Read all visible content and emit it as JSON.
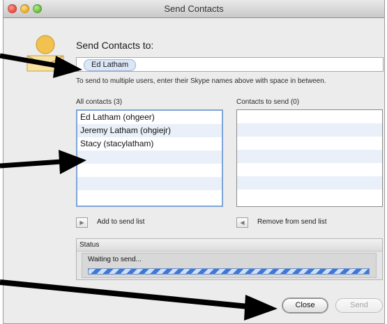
{
  "window": {
    "title": "Send Contacts"
  },
  "send_to": {
    "heading": "Send Contacts to:",
    "token": "Ed Latham",
    "hint": "To send to multiple users, enter their Skype names above with space in between."
  },
  "all_contacts": {
    "label": "All contacts (3)",
    "items": [
      "Ed Latham (ohgeer)",
      "Jeremy Latham (ohgiejr)",
      "Stacy (stacylatham)"
    ]
  },
  "contacts_to_send": {
    "label": "Contacts to send (0)",
    "items": []
  },
  "buttons": {
    "add_label": "Add to send list",
    "remove_label": "Remove from send list",
    "close_label": "Close",
    "send_label": "Send"
  },
  "status": {
    "title": "Status",
    "message": "Waiting to send...",
    "indeterminate": true
  },
  "colors": {
    "accent": "#3d78d6",
    "selection_border": "#7fa4d8",
    "row_alt": "#eaf0f9"
  }
}
